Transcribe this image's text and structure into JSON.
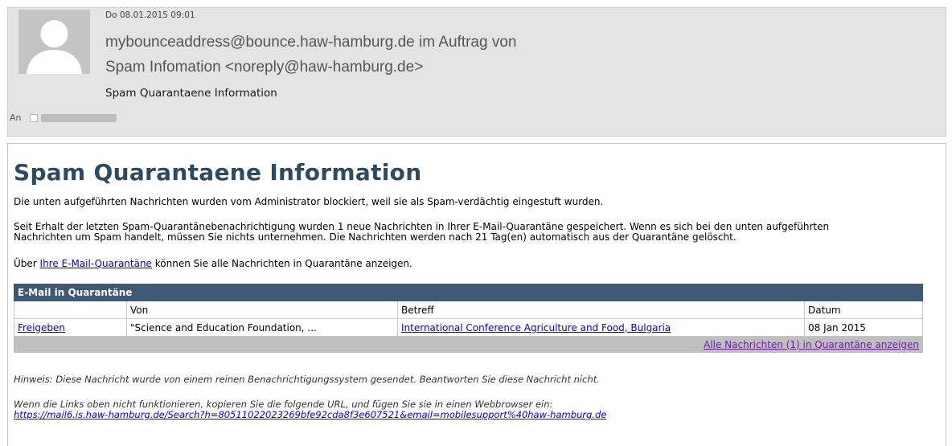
{
  "header": {
    "date": "Do 08.01.2015 09:01",
    "sender_line1": "mybounceaddress@bounce.haw-hamburg.de im Auftrag von",
    "sender_line2": "Spam Infomation <noreply@haw-hamburg.de>",
    "subject": "Spam Quarantaene Information",
    "to_label": "An",
    "avatar_icon": "person-silhouette-icon"
  },
  "body": {
    "title": "Spam Quarantaene Information",
    "para1": "Die unten aufgeführten Nachrichten wurden vom Administrator blockiert, weil sie als Spam-verdächtig eingestuft wurden.",
    "para2_line1": "Seit Erhalt der letzten Spam-Quarantänebenachrichtigung wurden 1 neue Nachrichten in Ihrer E-Mail-Quarantäne gespeichert. Wenn es sich bei den unten aufgeführten",
    "para2_line2": "Nachrichten um Spam handelt, müssen Sie nichts unternehmen. Die Nachrichten werden nach 21 Tag(en) automatisch aus der Quarantäne gelöscht.",
    "para3_prefix": "Über ",
    "para3_link": "Ihre E-Mail-Quarantäne",
    "para3_suffix": " können Sie alle Nachrichten in Quarantäne anzeigen."
  },
  "table": {
    "caption": "E-Mail in Quarantäne",
    "headers": [
      "",
      "Von",
      "Betreff",
      "Datum"
    ],
    "rows": [
      {
        "action": "Freigeben",
        "from": "\"Science and Education Foundation, ...",
        "subject": "International Conference Agriculture and Food, Bulgaria",
        "date": "08 Jan 2015"
      }
    ],
    "footer_link": "Alle Nachrichten (1) in Quarantäne anzeigen"
  },
  "notes": {
    "hint": "Hinweis: Diese Nachricht wurde von einem reinen Benachrichtigungssystem gesendet. Beantworten Sie diese Nachricht nicht.",
    "link_help": "Wenn die Links oben nicht funktionieren, kopieren Sie die folgende URL, und fügen Sie sie in einen Webbrowser ein:",
    "url": "https://mail6.is.haw-hamburg.de/Search?h=80511022023269bfe92cda8f3e607521&email=mobilesupport%40haw-hamburg.de"
  },
  "colors": {
    "title": "#2d4a63",
    "table_header": "#3f5873",
    "link": "#0000ee",
    "visited_link": "#6b1f9e",
    "header_bg": "#e4e4e4"
  }
}
